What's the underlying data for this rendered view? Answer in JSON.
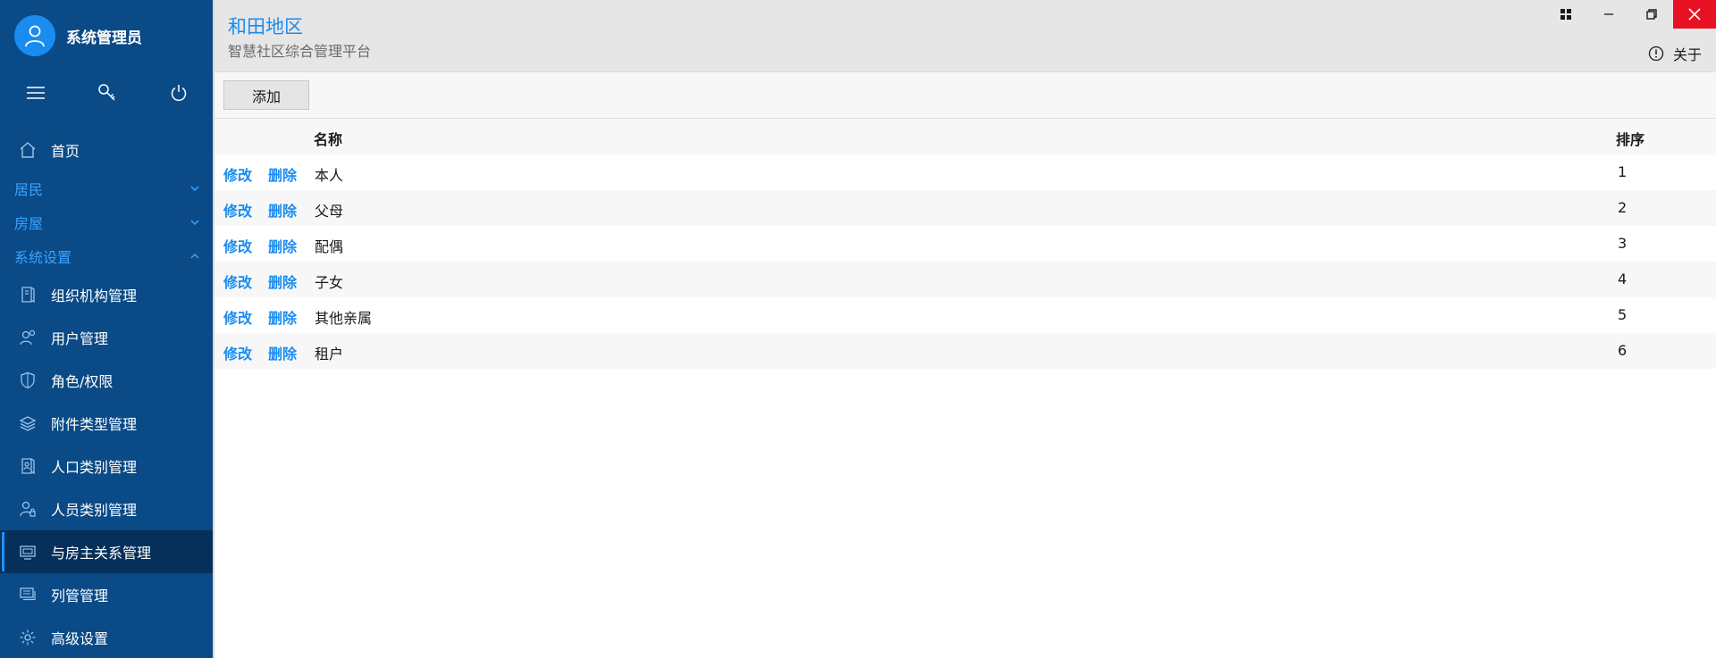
{
  "user": {
    "name": "系统管理员",
    "avatar_icon": "user-icon"
  },
  "sidebar": {
    "tools": [
      {
        "icon": "hamburger-menu-icon"
      },
      {
        "icon": "key-icon"
      },
      {
        "icon": "power-icon"
      }
    ],
    "home": {
      "label": "首页",
      "icon": "home-icon"
    },
    "groups": [
      {
        "label": "居民",
        "expanded": false
      },
      {
        "label": "房屋",
        "expanded": false
      },
      {
        "label": "系统设置",
        "expanded": true
      }
    ],
    "items": [
      {
        "label": "组织机构管理",
        "icon": "organization-icon"
      },
      {
        "label": "用户管理",
        "icon": "users-icon"
      },
      {
        "label": "角色/权限",
        "icon": "shield-icon"
      },
      {
        "label": "附件类型管理",
        "icon": "layers-icon"
      },
      {
        "label": "人口类别管理",
        "icon": "people-category-icon"
      },
      {
        "label": "人员类别管理",
        "icon": "person-lock-icon"
      },
      {
        "label": "与房主关系管理",
        "icon": "monitor-icon",
        "active": true
      },
      {
        "label": "列管管理",
        "icon": "monitor-stack-icon"
      },
      {
        "label": "高级设置",
        "icon": "gear-icon"
      }
    ],
    "colors": {
      "background": "#0a4a86",
      "active": "#06305a",
      "group_text": "#3aa3ff"
    }
  },
  "header": {
    "title": "和田地区",
    "subtitle": "智慧社区综合管理平台",
    "about_label": "关于",
    "window_buttons": [
      "grid-icon",
      "minimize-icon",
      "restore-icon",
      "close-icon"
    ]
  },
  "toolbar": {
    "add_label": "添加"
  },
  "table": {
    "columns": {
      "name": "名称",
      "order": "排序"
    },
    "edit_label": "修改",
    "delete_label": "删除",
    "rows": [
      {
        "name": "本人",
        "order": "1"
      },
      {
        "name": "父母",
        "order": "2"
      },
      {
        "name": "配偶",
        "order": "3"
      },
      {
        "name": "子女",
        "order": "4"
      },
      {
        "name": "其他亲属",
        "order": "5"
      },
      {
        "name": "租户",
        "order": "6"
      }
    ]
  },
  "colors": {
    "accent": "#1a8cf0",
    "close": "#e81123",
    "header_bg": "#e6e6e6"
  }
}
